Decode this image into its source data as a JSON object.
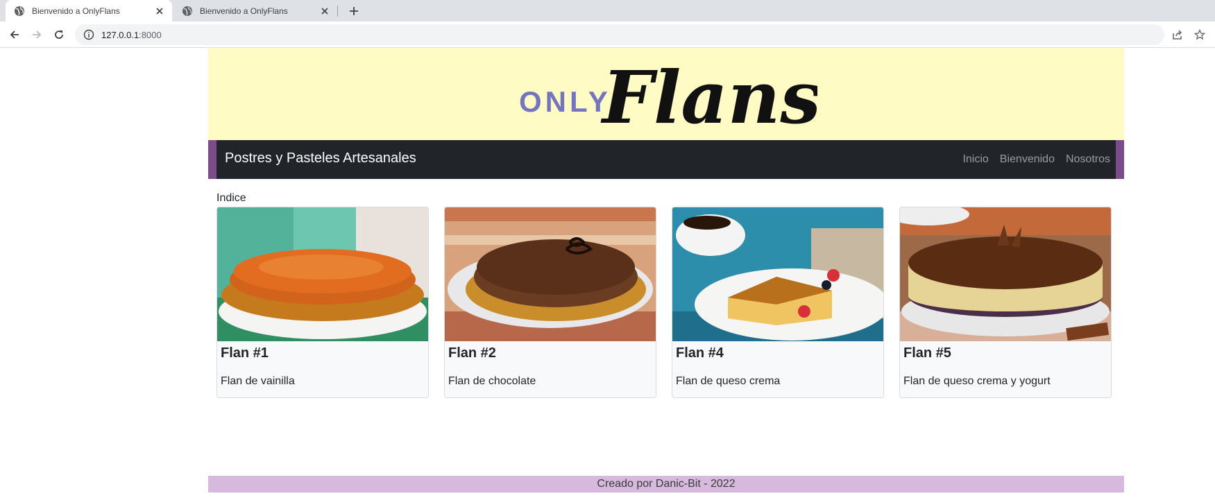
{
  "browser": {
    "tabs": [
      {
        "title": "Bienvenido a OnlyFlans",
        "active": true
      },
      {
        "title": "Bienvenido a OnlyFlans",
        "active": false
      }
    ],
    "url_host": "127.0.0.1",
    "url_port": ":8000",
    "icons": [
      "globe-icon",
      "close-icon",
      "plus-icon",
      "back-arrow-icon",
      "forward-arrow-icon",
      "reload-icon",
      "info-icon",
      "share-icon",
      "star-icon"
    ]
  },
  "header": {
    "logo_only": "ONLY",
    "logo_flans": "Flans",
    "banner_color": "#fefcc4"
  },
  "navbar": {
    "brand": "Postres y Pasteles Artesanales",
    "links": [
      "Inicio",
      "Bienvenido",
      "Nosotros"
    ],
    "accent_color": "#7a4c8a"
  },
  "main": {
    "heading": "Indice",
    "cards": [
      {
        "title": "Flan #1",
        "text": "Flan de vainilla"
      },
      {
        "title": "Flan #2",
        "text": "Flan de chocolate"
      },
      {
        "title": "Flan #4",
        "text": "Flan de queso crema"
      },
      {
        "title": "Flan #5",
        "text": "Flan de queso crema y yogurt"
      }
    ]
  },
  "footer": {
    "text": "Creado por Danic-Bit - 2022",
    "color": "#d7b9dd"
  }
}
